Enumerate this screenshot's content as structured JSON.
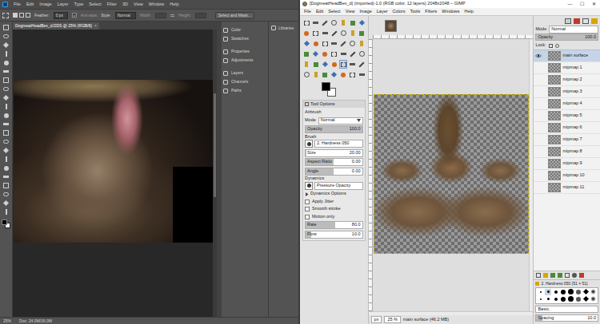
{
  "photoshop": {
    "menu": [
      "File",
      "Edit",
      "Image",
      "Layer",
      "Type",
      "Select",
      "Filter",
      "3D",
      "View",
      "Window",
      "Help"
    ],
    "options": {
      "feather_label": "Feather:",
      "feather_value": "0 px",
      "antialias_label": "Anti-alias",
      "antialias_checked": true,
      "style_label": "Style:",
      "style_value": "Normal",
      "width_label": "Width:",
      "height_label": "Height:",
      "select_mask": "Select and Mask..."
    },
    "document_tab": {
      "title": "DogmeatHeadBev_d.DDS @ 25% (RGB/8)",
      "close": "×"
    },
    "panels": [
      "Color",
      "Swatches",
      "Properties",
      "Adjustments",
      "Layers",
      "Channels",
      "Paths"
    ],
    "libraries": "Libraries",
    "status": {
      "zoom": "25%",
      "doc": "Doc: 24.0M/16.0M"
    }
  },
  "gimp": {
    "title": "[DogmeatHeadBev_d] (imported)-1.0 (RGB color, 12 layers) 2048x2048 – GIMP",
    "window_buttons": [
      "—",
      "☐",
      "✕"
    ],
    "menu": [
      "File",
      "Edit",
      "Select",
      "View",
      "Image",
      "Layer",
      "Colors",
      "Tools",
      "Filters",
      "Windows",
      "Help"
    ],
    "tool_options": {
      "header": "Tool Options",
      "rows": [
        {
          "kind": "heading",
          "label": "Airbrush"
        },
        {
          "kind": "dropdown",
          "label": "Mode",
          "value": "Normal"
        },
        {
          "kind": "slider",
          "label": "Opacity",
          "value": "100.0",
          "level": 1
        },
        {
          "kind": "brush",
          "label": "Brush",
          "value": "2. Hardness 050"
        },
        {
          "kind": "slider",
          "label": "Size",
          "value": "20.00",
          "level": 0.02
        },
        {
          "kind": "slider",
          "label": "Aspect Ratio",
          "value": "0.00",
          "level": 0.5
        },
        {
          "kind": "slider",
          "label": "Angle",
          "value": "0.00",
          "level": 0.5
        },
        {
          "kind": "brush",
          "label": "Dynamics",
          "value": "Pressure Opacity"
        },
        {
          "kind": "expander",
          "label": "Dynamics Options",
          "expanded": false
        },
        {
          "kind": "checkbox",
          "label": "Apply Jitter",
          "checked": false
        },
        {
          "kind": "checkbox",
          "label": "Smooth stroke",
          "checked": false
        },
        {
          "kind": "checkbox",
          "label": "Motion only",
          "checked": false
        },
        {
          "kind": "slider",
          "label": "Rate",
          "value": "80.0",
          "level": 0.53
        },
        {
          "kind": "slider",
          "label": "Flow",
          "value": "10.0",
          "level": 0.1
        }
      ]
    },
    "layers": {
      "mode_label": "Mode",
      "mode_value": "Normal",
      "opacity_label": "Opacity",
      "opacity_value": "100.0",
      "opacity_level": 1,
      "lock_label": "Lock:",
      "items": [
        {
          "name": "main surface",
          "visible": true,
          "selected": true
        },
        {
          "name": "mipmap 1",
          "visible": false,
          "selected": false
        },
        {
          "name": "mipmap 2",
          "visible": false,
          "selected": false
        },
        {
          "name": "mipmap 3",
          "visible": false,
          "selected": false
        },
        {
          "name": "mipmap 4",
          "visible": false,
          "selected": false
        },
        {
          "name": "mipmap 5",
          "visible": false,
          "selected": false
        },
        {
          "name": "mipmap 6",
          "visible": false,
          "selected": false
        },
        {
          "name": "mipmap 7",
          "visible": false,
          "selected": false
        },
        {
          "name": "mipmap 8",
          "visible": false,
          "selected": false
        },
        {
          "name": "mipmap 9",
          "visible": false,
          "selected": false
        },
        {
          "name": "mipmap 10",
          "visible": false,
          "selected": false
        },
        {
          "name": "mipmap 11",
          "visible": false,
          "selected": false
        }
      ]
    },
    "brushes": {
      "selected_name": "2. Hardness 050 (51 × 51)",
      "tag_filter": "Basic.",
      "spacing_label": "Spacing",
      "spacing_value": "10.0",
      "spacing_level": 0.1
    },
    "status": {
      "unit": "px",
      "zoom": "25 %",
      "layer": "main surface (46.2 MB)"
    }
  }
}
